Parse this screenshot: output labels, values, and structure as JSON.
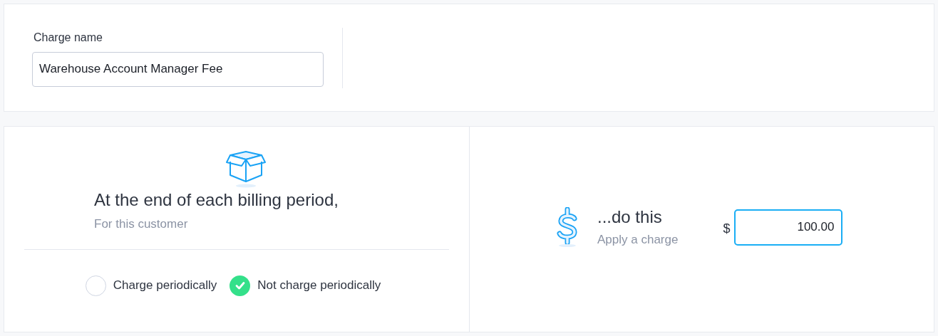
{
  "charge_name": {
    "label": "Charge name",
    "value": "Warehouse Account Manager Fee"
  },
  "trigger": {
    "title": "At the end of each billing period,",
    "subtitle": "For this customer",
    "options": [
      {
        "label": "Charge periodically",
        "selected": false
      },
      {
        "label": "Not charge periodically",
        "selected": true
      }
    ]
  },
  "action": {
    "title": "...do this",
    "subtitle": "Apply a charge",
    "currency": "$",
    "amount": "100.00"
  }
}
